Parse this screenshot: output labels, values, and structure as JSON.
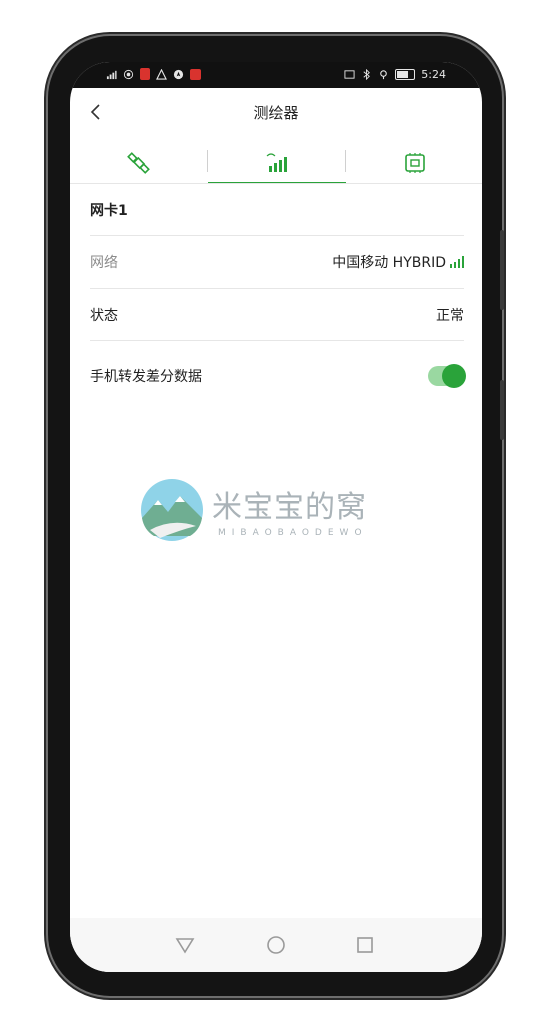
{
  "status_bar": {
    "time": "5:24",
    "left_icons": [
      "signal-icon",
      "hotspot-icon",
      "notification-icon",
      "warning-icon",
      "compass-icon",
      "app-icon"
    ],
    "right_icons": [
      "nfc-icon",
      "bluetooth-icon",
      "location-icon",
      "battery-icon"
    ]
  },
  "header": {
    "title": "测绘器",
    "back_icon": "chevron-left-icon"
  },
  "tabs": [
    {
      "icon": "satellite-icon",
      "active": false
    },
    {
      "icon": "signal-bars-icon",
      "active": true
    },
    {
      "icon": "chip-icon",
      "active": false
    }
  ],
  "section": {
    "title": "网卡1"
  },
  "rows": [
    {
      "label": "网络",
      "value": "中国移动 HYBRID"
    },
    {
      "label": "状态",
      "value": "正常"
    }
  ],
  "toggle": {
    "label": "手机转发差分数据",
    "on": true
  },
  "watermark": {
    "title": "米宝宝的窝",
    "subtitle": "MIBAOBAODEWO"
  },
  "colors": {
    "accent": "#2aa33a",
    "switch_track": "#9ad8a1",
    "divider": "#e6e6e6",
    "muted_text": "#8b8b8b"
  },
  "navbar": {
    "icons": [
      "back-triangle-icon",
      "home-circle-icon",
      "recents-square-icon"
    ]
  }
}
